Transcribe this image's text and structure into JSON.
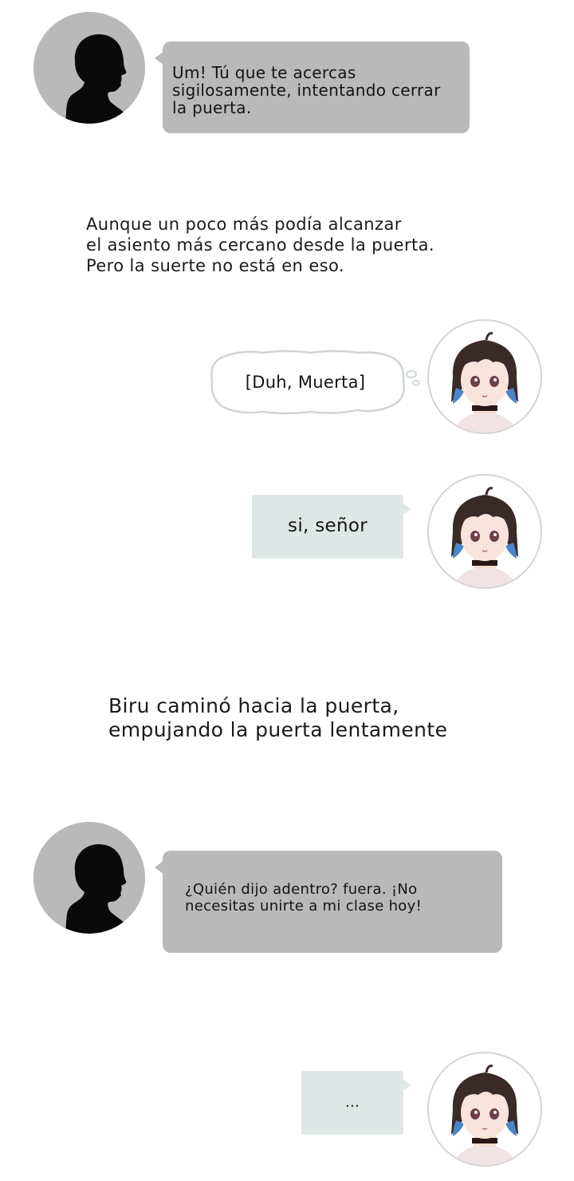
{
  "dialogue": [
    {
      "speaker": "man",
      "text": "Um!  Tú que te acercas\nsigilosamente, intentando cerrar\nla puerta."
    },
    {
      "speaker": "narration",
      "text": "Aunque un poco más podía alcanzar\nel asiento más cercano desde la puerta.\nPero la suerte no está en eso."
    },
    {
      "speaker": "girl",
      "style": "thought",
      "text": "[Duh, Muerta]"
    },
    {
      "speaker": "girl",
      "text": "si, señor"
    },
    {
      "speaker": "narration",
      "text": "Biru caminó hacia la puerta,\nempujando la puerta lentamente"
    },
    {
      "speaker": "man",
      "text": "¿Quién dijo adentro? fuera.  ¡No\nnecesitas unirte a mi clase hoy!"
    },
    {
      "speaker": "girl",
      "text": "..."
    }
  ],
  "colors": {
    "gray_bubble": "#b9b9b9",
    "mint_bubble": "#dfe7e6",
    "silhouette": "#0a0a0a",
    "avatar_bg": "#b9b9b9",
    "hair": "#3a2a28",
    "hair_blue": "#4a86c8"
  },
  "icons": [
    "man-silhouette-avatar",
    "girl-avatar",
    "thought-cloud"
  ]
}
